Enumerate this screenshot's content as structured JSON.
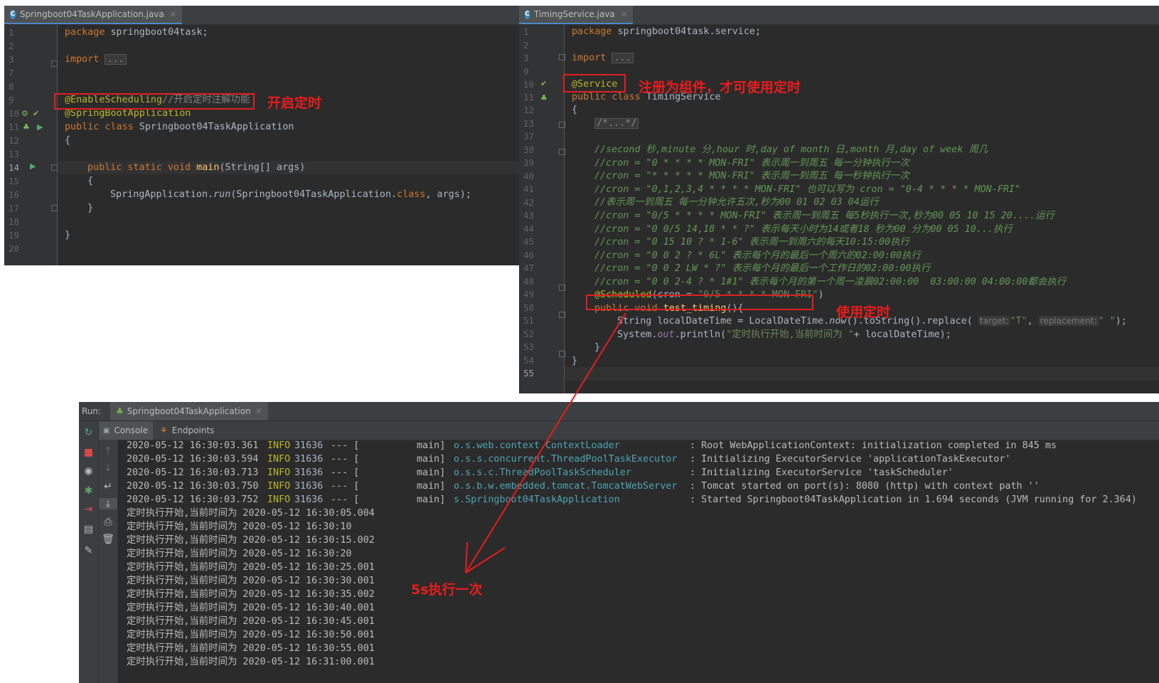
{
  "left_editor": {
    "tab": "Springboot04TaskApplication.java",
    "tab_icon": "C",
    "line_numbers": [
      "1",
      "2",
      "3",
      "7",
      "8",
      "9",
      "10",
      "11",
      "12",
      "13",
      "14",
      "15",
      "16",
      "17",
      "18",
      "19",
      "20"
    ],
    "lines": {
      "l1_kw": "package",
      "l1_rest": " springboot04task;",
      "l3_kw": "import",
      "l3_fold": "...",
      "l9_ann": "@EnableScheduling",
      "l9_com": "//开启定时注解功能",
      "l10_ann": "@SpringBootApplication",
      "l11_kw": "public class",
      "l11_rest": " Springboot04TaskApplication",
      "l12": "{",
      "l14_kw": "public static void",
      "l14_fn": " main",
      "l14_rest": "(String[] args)",
      "l15": "{",
      "l16_a": "SpringApplication.",
      "l16_run": "run",
      "l16_b": "(Springboot04TaskApplication.",
      "l16_class": "class",
      "l16_c": ", args);",
      "l17": "}",
      "l19": "}"
    },
    "annotation_label": "开启定时"
  },
  "right_editor": {
    "tab": "TimingService.java",
    "tab_icon": "C",
    "line_numbers": [
      "1",
      "2",
      "3",
      "9",
      "10",
      "11",
      "12",
      "13",
      "37",
      "38",
      "39",
      "40",
      "41",
      "42",
      "43",
      "44",
      "45",
      "46",
      "47",
      "48",
      "49",
      "50",
      "51",
      "52",
      "53",
      "54",
      "55"
    ],
    "lines": {
      "l1_kw": "package",
      "l1_rest": " springboot04task.service;",
      "l3_kw": "import",
      "l3_fold": "...",
      "l10_ann": "@Service",
      "l11_kw": "public class",
      "l11_rest": " TimingService",
      "l12": "{",
      "l13_fold": "/*...*/",
      "c38": "//second 秒,minute 分,hour 时,day of month 日,month 月,day of week 周几",
      "c39": "//cron = \"0 * * * * MON-FRI\" 表示周一到周五 每一分钟执行一次",
      "c40": "//cron = \"* * * * * MON-FRI\" 表示周一到周五 每一秒钟执行一次",
      "c41": "//cron = \"0,1,2,3,4 * * * * MON-FRI\" 也可以写为 cron = \"0-4 * * * * MON-FRI\"",
      "c42": "//表示周一到周五 每一分钟允许五次,秒为00 01 02 03 04运行",
      "c43": "//cron = \"0/5 * * * * MON-FRI\" 表示周一到周五 每5秒执行一次,秒为00 05 10 15 20....运行",
      "c44": "//cron = \"0 0/5 14,18 * * ?\" 表示每天小时为14或者18 秒为00 分为00 05 10...执行",
      "c45": "//cron = \"0 15 10 ? * 1-6\" 表示周一到周六的每天10:15:00执行",
      "c46": "//cron = \"0 0 2 ? * 6L\" 表示每个月的最后一个周六的02:00:00执行",
      "c47": "//cron = \"0 0 2 LW * ?\" 表示每个月的最后一个工作日的02:00:00执行",
      "c48": "//cron = \"0 0 2-4 ? * 1#1\" 表示每个月的第一个周一凌晨02:00:00  03:00:00 04:00:00都会执行",
      "l49_ann": "@Scheduled",
      "l49_a": "(cron = ",
      "l49_str": "\"0/5 * * * * MON-FRI\"",
      "l49_b": ")",
      "l50_kw": "public void",
      "l50_fn": " test_timing",
      "l50_rest": "(){",
      "l51_a": "String localDateTime = LocalDateTime.",
      "l51_now": "now",
      "l51_b": "().toString().replace(",
      "l51_hint1": "target:",
      "l51_s1": "\"T\"",
      "l51_c": ",",
      "l51_hint2": "replacement:",
      "l51_s2": "\" \"",
      "l51_d": ");",
      "l52_a": "System.",
      "l52_out": "out",
      "l52_b": ".println(",
      "l52_str": "\"定时执行开始,当前时间为 \"",
      "l52_c": "+ localDateTime);",
      "l53": "}",
      "l54": "}"
    },
    "service_label": "注册为组件，才可使用定时",
    "scheduled_label": "使用定时"
  },
  "run_panel": {
    "run_label": "Run:",
    "run_tab": "Springboot04TaskApplication",
    "console_tab": "Console",
    "endpoints_tab": "Endpoints",
    "log_lines": [
      {
        "ts": "2020-05-12 16:30:03.361",
        "level": "INFO",
        "pid": "31636",
        "sep": "--- [",
        "thread": "main]",
        "logger": "o.s.web.context.ContextLoader",
        "msg": ": Root WebApplicationContext: initialization completed in 845 ms"
      },
      {
        "ts": "2020-05-12 16:30:03.594",
        "level": "INFO",
        "pid": "31636",
        "sep": "--- [",
        "thread": "main]",
        "logger": "o.s.s.concurrent.ThreadPoolTaskExecutor",
        "msg": ": Initializing ExecutorService 'applicationTaskExecutor'"
      },
      {
        "ts": "2020-05-12 16:30:03.713",
        "level": "INFO",
        "pid": "31636",
        "sep": "--- [",
        "thread": "main]",
        "logger": "o.s.s.c.ThreadPoolTaskScheduler",
        "msg": ": Initializing ExecutorService 'taskScheduler'"
      },
      {
        "ts": "2020-05-12 16:30:03.750",
        "level": "INFO",
        "pid": "31636",
        "sep": "--- [",
        "thread": "main]",
        "logger": "o.s.b.w.embedded.tomcat.TomcatWebServer",
        "msg": ": Tomcat started on port(s): 8080 (http) with context path ''"
      },
      {
        "ts": "2020-05-12 16:30:03.752",
        "level": "INFO",
        "pid": "31636",
        "sep": "--- [",
        "thread": "main]",
        "logger": "s.Springboot04TaskApplication",
        "msg": ": Started Springboot04TaskApplication in 1.694 seconds (JVM running for 2.364)"
      }
    ],
    "timer_lines": [
      "定时执行开始,当前时间为 2020-05-12 16:30:05.004",
      "定时执行开始,当前时间为 2020-05-12 16:30:10",
      "定时执行开始,当前时间为 2020-05-12 16:30:15.002",
      "定时执行开始,当前时间为 2020-05-12 16:30:20",
      "定时执行开始,当前时间为 2020-05-12 16:30:25.001",
      "定时执行开始,当前时间为 2020-05-12 16:30:30.001",
      "定时执行开始,当前时间为 2020-05-12 16:30:35.002",
      "定时执行开始,当前时间为 2020-05-12 16:30:40.001",
      "定时执行开始,当前时间为 2020-05-12 16:30:45.001",
      "定时执行开始,当前时间为 2020-05-12 16:30:50.001",
      "定时执行开始,当前时间为 2020-05-12 16:30:55.001",
      "定时执行开始,当前时间为 2020-05-12 16:31:00.001"
    ],
    "interval_label": "5s执行一次"
  },
  "colors": {
    "annotation_red": "#e81c1c",
    "editor_bg": "#2b2b2b",
    "keyword": "#cc7832",
    "annotation": "#bbb529",
    "string": "#6a8759",
    "comment": "#629755"
  }
}
